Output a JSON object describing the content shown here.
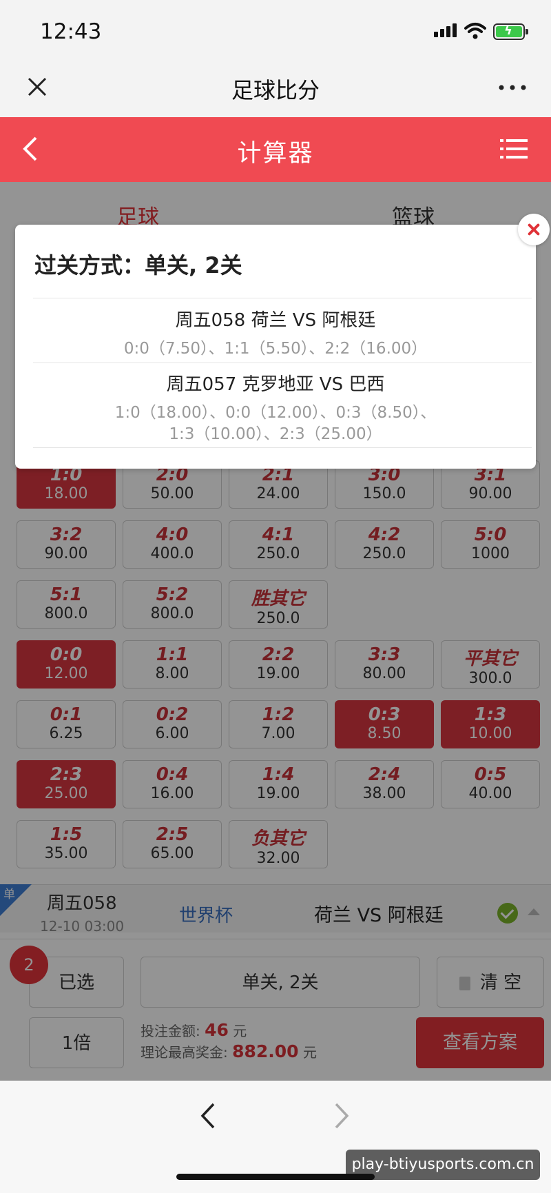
{
  "status_bar": {
    "time": "12:43"
  },
  "browser": {
    "title": "足球比分"
  },
  "app_header": {
    "title": "计算器"
  },
  "tabs": [
    {
      "label": "足球"
    },
    {
      "label": "篮球"
    }
  ],
  "score_grid": [
    {
      "score": "1:0",
      "odds": "18.00",
      "selected": true
    },
    {
      "score": "2:0",
      "odds": "50.00",
      "selected": false
    },
    {
      "score": "2:1",
      "odds": "24.00",
      "selected": false
    },
    {
      "score": "3:0",
      "odds": "150.0",
      "selected": false
    },
    {
      "score": "3:1",
      "odds": "90.00",
      "selected": false
    },
    {
      "score": "3:2",
      "odds": "90.00",
      "selected": false
    },
    {
      "score": "4:0",
      "odds": "400.0",
      "selected": false
    },
    {
      "score": "4:1",
      "odds": "250.0",
      "selected": false
    },
    {
      "score": "4:2",
      "odds": "250.0",
      "selected": false
    },
    {
      "score": "5:0",
      "odds": "1000",
      "selected": false
    },
    {
      "score": "5:1",
      "odds": "800.0",
      "selected": false
    },
    {
      "score": "5:2",
      "odds": "800.0",
      "selected": false
    },
    {
      "score": "胜其它",
      "odds": "250.0",
      "selected": false
    },
    {
      "score": "0:0",
      "odds": "12.00",
      "selected": true
    },
    {
      "score": "1:1",
      "odds": "8.00",
      "selected": false
    },
    {
      "score": "2:2",
      "odds": "19.00",
      "selected": false
    },
    {
      "score": "3:3",
      "odds": "80.00",
      "selected": false
    },
    {
      "score": "平其它",
      "odds": "300.0",
      "selected": false
    },
    {
      "score": "0:1",
      "odds": "6.25",
      "selected": false
    },
    {
      "score": "0:2",
      "odds": "6.00",
      "selected": false
    },
    {
      "score": "1:2",
      "odds": "7.00",
      "selected": false
    },
    {
      "score": "0:3",
      "odds": "8.50",
      "selected": true
    },
    {
      "score": "1:3",
      "odds": "10.00",
      "selected": true
    },
    {
      "score": "2:3",
      "odds": "25.00",
      "selected": true
    },
    {
      "score": "0:4",
      "odds": "16.00",
      "selected": false
    },
    {
      "score": "1:4",
      "odds": "19.00",
      "selected": false
    },
    {
      "score": "2:4",
      "odds": "38.00",
      "selected": false
    },
    {
      "score": "0:5",
      "odds": "40.00",
      "selected": false
    },
    {
      "score": "1:5",
      "odds": "35.00",
      "selected": false
    },
    {
      "score": "2:5",
      "odds": "65.00",
      "selected": false
    },
    {
      "score": "负其它",
      "odds": "32.00",
      "selected": false
    }
  ],
  "match_row": {
    "flag": "单",
    "code": "周五058",
    "time": "12-10 03:00",
    "league": "世界杯",
    "teams": "荷兰 VS 阿根廷"
  },
  "bottom_panel": {
    "badge_count": "2",
    "selected_label": "已选",
    "pass_mode": "单关, 2关",
    "clear_label": "清 空",
    "multiplier": "1倍",
    "bet_amount_label": "投注金额:",
    "bet_amount": "46",
    "max_prize_label": "理论最高奖金:",
    "max_prize": "882.00",
    "currency": "元",
    "view_plan_label": "查看方案"
  },
  "modal": {
    "title": "过关方式：单关, 2关",
    "matches": [
      {
        "name": "周五058 荷兰 VS 阿根廷",
        "picks_line1": "0:0（7.50）、1:1（5.50）、2:2（16.00）",
        "picks_line2": ""
      },
      {
        "name": "周五057 克罗地亚 VS 巴西",
        "picks_line1": "1:0（18.00）、0:0（12.00）、0:3（8.50）、",
        "picks_line2": "1:3（10.00）、2:3（25.00）"
      }
    ]
  },
  "watermark": "play-btiyusports.com.cn",
  "colors": {
    "accent_red": "#f04a52",
    "selected_red": "#d83640",
    "league_blue": "#3a6fc0"
  }
}
